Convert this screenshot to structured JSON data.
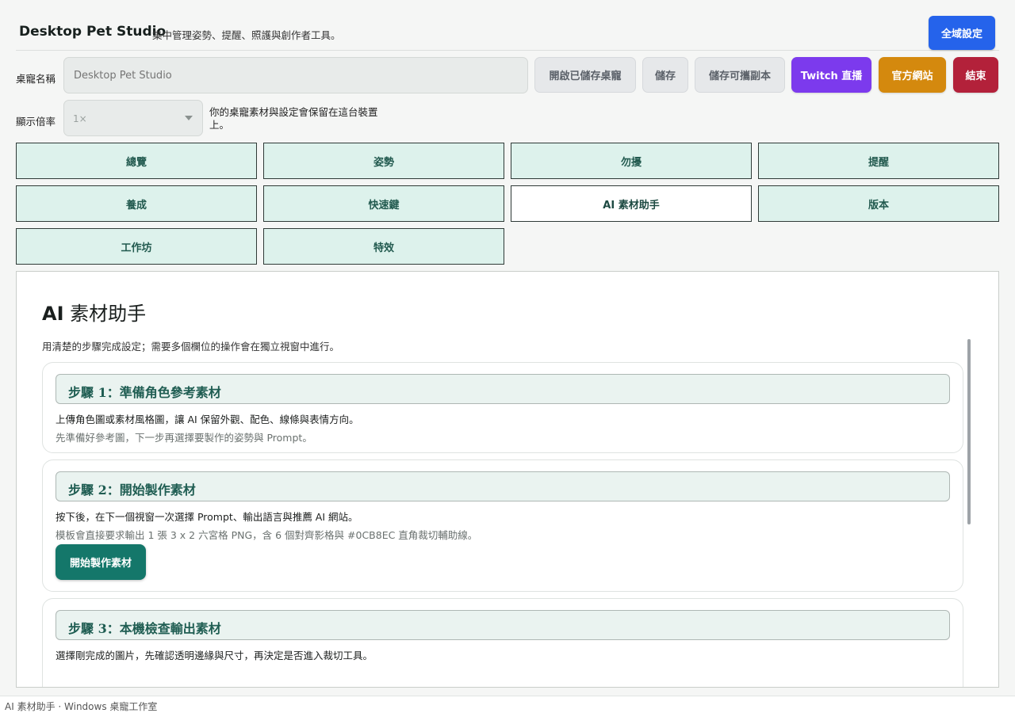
{
  "header": {
    "title": "Desktop Pet Studio",
    "subtitle": "集中管理姿勢、提醒、照護與創作者工具。",
    "global_settings": "全域設定"
  },
  "pet_name": {
    "label": "桌寵名稱",
    "placeholder": "Desktop Pet Studio"
  },
  "actions": {
    "open_saved": "開啟已儲存桌寵",
    "save": "儲存",
    "save_portable": "儲存可攜副本",
    "twitch": "Twitch 直播",
    "website": "官方網站",
    "exit": "結束"
  },
  "scale": {
    "label": "顯示倍率",
    "value": "1×",
    "note": "你的桌寵素材與設定會保留在這台裝置上。"
  },
  "tabs": [
    {
      "label": "總覽"
    },
    {
      "label": "姿勢"
    },
    {
      "label": "勿擾"
    },
    {
      "label": "提醒"
    },
    {
      "label": "養成"
    },
    {
      "label": "快速鍵"
    },
    {
      "label": "AI 素材助手"
    },
    {
      "label": "版本"
    },
    {
      "label": "工作坊"
    },
    {
      "label": "特效"
    }
  ],
  "active_tab": "AI 素材助手",
  "panel": {
    "title_prefix": "AI",
    "title_rest": " 素材助手",
    "description": "用清楚的步驟完成設定；需要多個欄位的操作會在獨立視窗中進行。",
    "steps": [
      {
        "title": "步驟 1：準備角色參考素材",
        "main": "上傳角色圖或素材風格圖，讓 AI 保留外觀、配色、線條與表情方向。",
        "sub": "先準備好參考圖，下一步再選擇要製作的姿勢與 Prompt。"
      },
      {
        "title": "步驟 2：開始製作素材",
        "main": "按下後，在下一個視窗一次選擇 Prompt、輸出語言與推薦 AI 網站。",
        "sub": "模板會直接要求輸出 1 張 3 x 2 六宮格 PNG，含 6 個對齊影格與 #0CB8EC 直角裁切輔助線。",
        "button": "開始製作素材"
      },
      {
        "title": "步驟 3：本機檢查輸出素材",
        "main": "選擇剛完成的圖片，先確認透明邊緣與尺寸，再決定是否進入裁切工具。"
      }
    ]
  },
  "footer": {
    "text": "AI 素材助手 · Windows 桌寵工作室"
  },
  "colors": {
    "primary_blue": "#2563eb",
    "twitch_purple": "#7c3aed",
    "website_amber": "#d4890e",
    "exit_red": "#b3213a",
    "teal_button": "#14776a",
    "tab_background": "#ddf2ec"
  }
}
